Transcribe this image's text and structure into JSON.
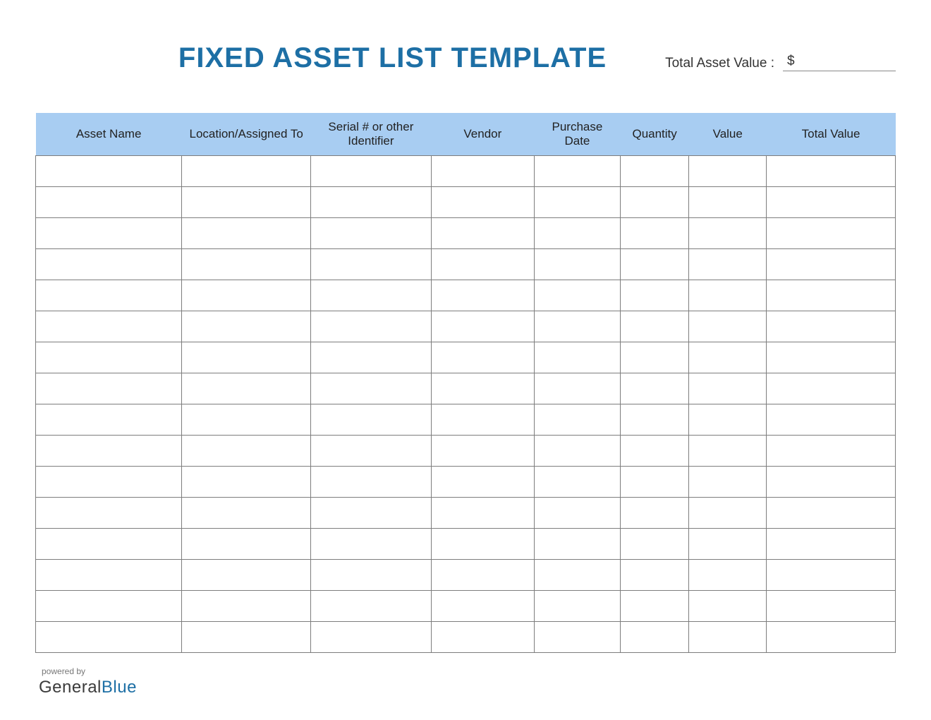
{
  "title": "FIXED ASSET LIST TEMPLATE",
  "total": {
    "label": "Total Asset Value :",
    "currency": "$",
    "value": ""
  },
  "columns": [
    "Asset Name",
    "Location/Assigned To",
    "Serial # or other Identifier",
    "Vendor",
    "Purchase Date",
    "Quantity",
    "Value",
    "Total Value"
  ],
  "rows": [
    [
      "",
      "",
      "",
      "",
      "",
      "",
      "",
      ""
    ],
    [
      "",
      "",
      "",
      "",
      "",
      "",
      "",
      ""
    ],
    [
      "",
      "",
      "",
      "",
      "",
      "",
      "",
      ""
    ],
    [
      "",
      "",
      "",
      "",
      "",
      "",
      "",
      ""
    ],
    [
      "",
      "",
      "",
      "",
      "",
      "",
      "",
      ""
    ],
    [
      "",
      "",
      "",
      "",
      "",
      "",
      "",
      ""
    ],
    [
      "",
      "",
      "",
      "",
      "",
      "",
      "",
      ""
    ],
    [
      "",
      "",
      "",
      "",
      "",
      "",
      "",
      ""
    ],
    [
      "",
      "",
      "",
      "",
      "",
      "",
      "",
      ""
    ],
    [
      "",
      "",
      "",
      "",
      "",
      "",
      "",
      ""
    ],
    [
      "",
      "",
      "",
      "",
      "",
      "",
      "",
      ""
    ],
    [
      "",
      "",
      "",
      "",
      "",
      "",
      "",
      ""
    ],
    [
      "",
      "",
      "",
      "",
      "",
      "",
      "",
      ""
    ],
    [
      "",
      "",
      "",
      "",
      "",
      "",
      "",
      ""
    ],
    [
      "",
      "",
      "",
      "",
      "",
      "",
      "",
      ""
    ],
    [
      "",
      "",
      "",
      "",
      "",
      "",
      "",
      ""
    ]
  ],
  "footer": {
    "powered": "powered by",
    "brand1": "General",
    "brand2": "Blue"
  }
}
